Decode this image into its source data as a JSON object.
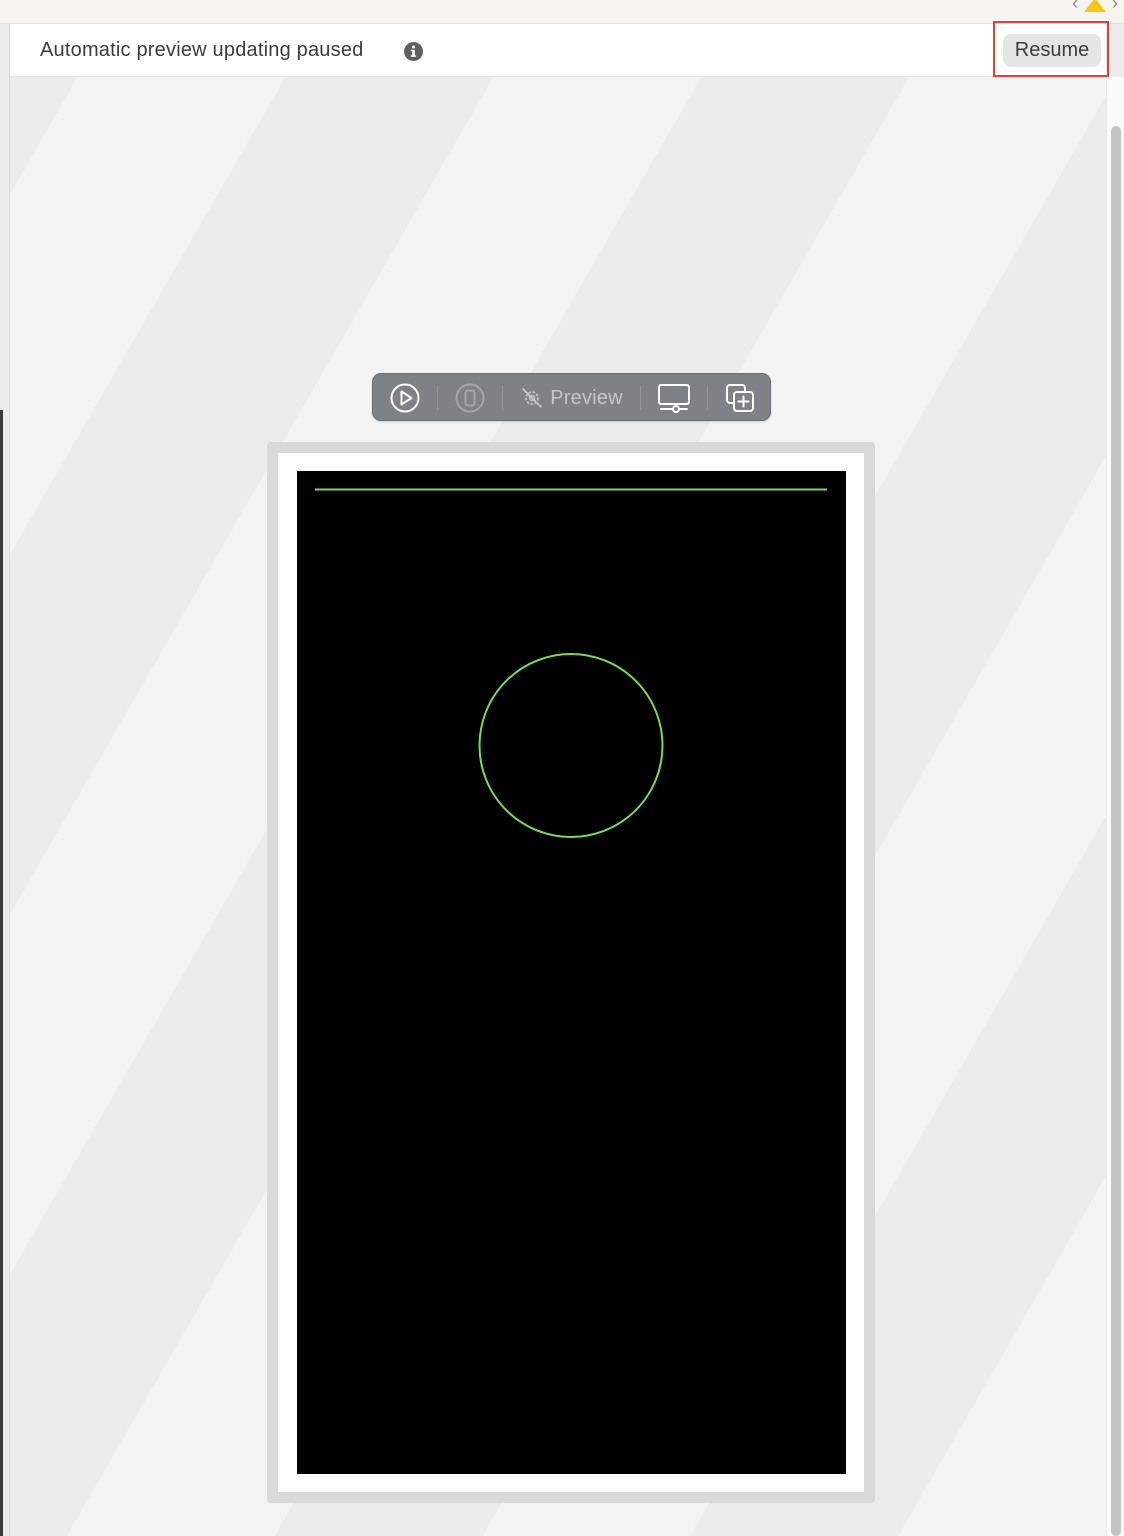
{
  "status_bar": {
    "message": "Automatic preview updating paused",
    "info_icon": "info-circle-icon",
    "resume_label": "Resume",
    "highlight_color": "#d6463a"
  },
  "preview_toolbar": {
    "live_icon": "play-circle-icon",
    "selectable_icon": "device-select-icon",
    "variants_icon": "variants-gear-icon",
    "preview_label": "Preview",
    "device_settings_icon": "display-settings-icon",
    "duplicate_icon": "add-preview-icon"
  },
  "device_preview": {
    "background": "#000000",
    "stroke_color": "#7ed957",
    "shapes": [
      "horizontal-line",
      "circle-outline"
    ]
  },
  "colors": {
    "canvas": "#efefef",
    "toolbar": "#7e8186",
    "warning": "#f5c518"
  }
}
